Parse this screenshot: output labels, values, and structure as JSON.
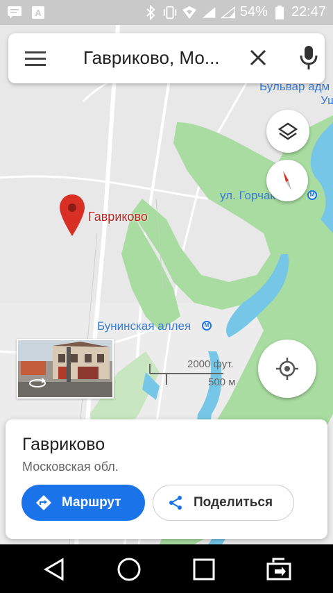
{
  "status_bar": {
    "battery": "54%",
    "time": "22:47",
    "icons": [
      "chat-icon",
      "font-icon",
      "bluetooth-icon",
      "vibrate-icon",
      "wifi-icon",
      "signal-icon",
      "signal-icon",
      "battery-icon"
    ]
  },
  "search": {
    "query": "Гаврико­во, Мо...",
    "menu_icon": "menu-icon",
    "clear_icon": "close-icon",
    "mic_icon": "mic-icon"
  },
  "map": {
    "pin_label": "Гаврико­во",
    "labels": {
      "bulvar": "Бульвар адм",
      "bulvar2": "Уш",
      "gorchakova": "ул. Горчакова",
      "buninskaya": "Бунинская аллея"
    },
    "scale": {
      "feet": "2000 фут.",
      "meters": "500 м"
    }
  },
  "place_card": {
    "title": "Гаврико­во",
    "subtitle": "Московская обл.",
    "route_button": "Маршрут",
    "share_button": "Поделиться"
  },
  "colors": {
    "accent": "#1a73e8",
    "park_green": "#a8dca0",
    "water": "#76c6e8",
    "pin_red": "#d93025",
    "metro_blue": "#1a73e8"
  }
}
